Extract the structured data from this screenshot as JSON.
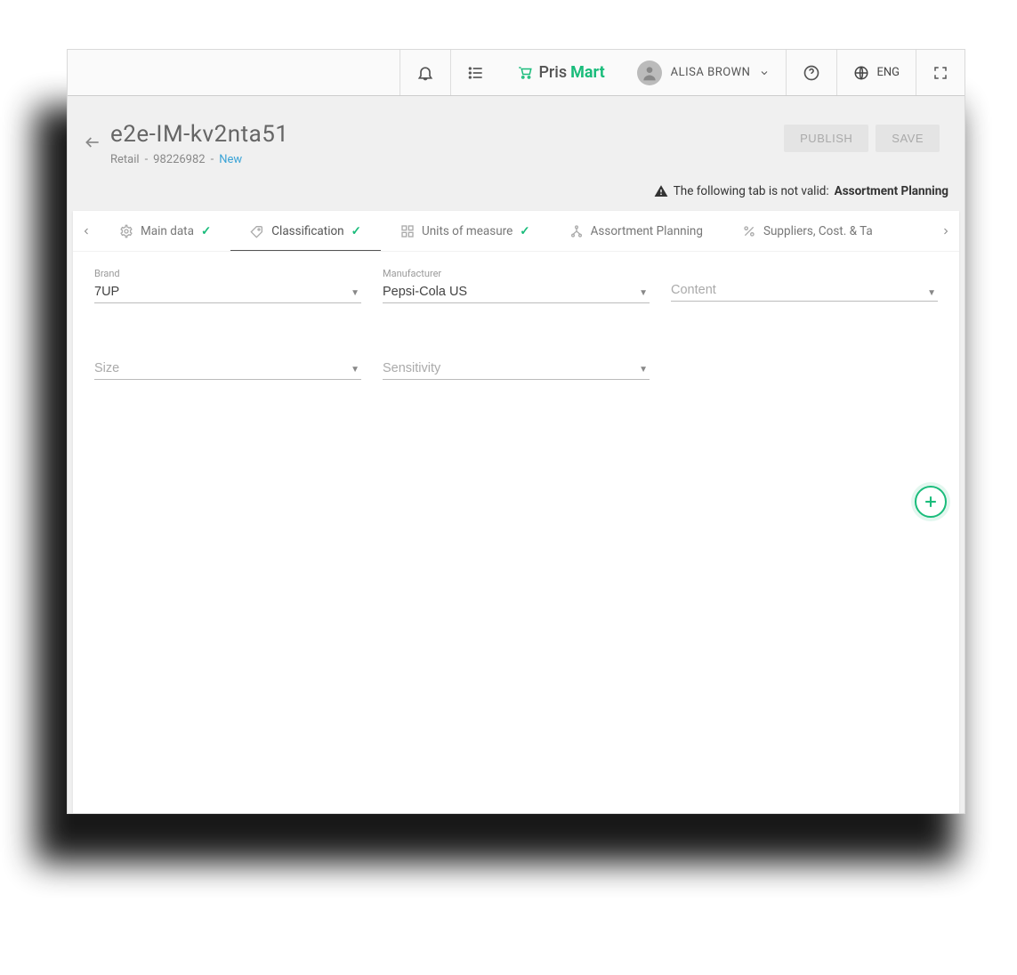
{
  "topbar": {
    "logo_pris": "Pris",
    "logo_mart": "Mart",
    "user_name": "ALISA BROWN",
    "language": "ENG"
  },
  "header": {
    "title": "e2e-IM-kv2nta51",
    "crumb_category": "Retail",
    "crumb_sep": "-",
    "crumb_id": "98226982",
    "crumb_status": "New",
    "publish_label": "PUBLISH",
    "save_label": "SAVE"
  },
  "warning": {
    "message": "The following tab is not valid:",
    "tab_name": "Assortment Planning"
  },
  "tabs": {
    "main_data": "Main data",
    "classification": "Classification",
    "units": "Units of measure",
    "assortment": "Assortment Planning",
    "suppliers": "Suppliers, Cost. & Ta"
  },
  "form": {
    "brand": {
      "label": "Brand",
      "value": "7UP"
    },
    "manufacturer": {
      "label": "Manufacturer",
      "value": "Pepsi-Cola US"
    },
    "content": {
      "placeholder": "Content"
    },
    "size": {
      "placeholder": "Size"
    },
    "sensitivity": {
      "placeholder": "Sensitivity"
    }
  }
}
